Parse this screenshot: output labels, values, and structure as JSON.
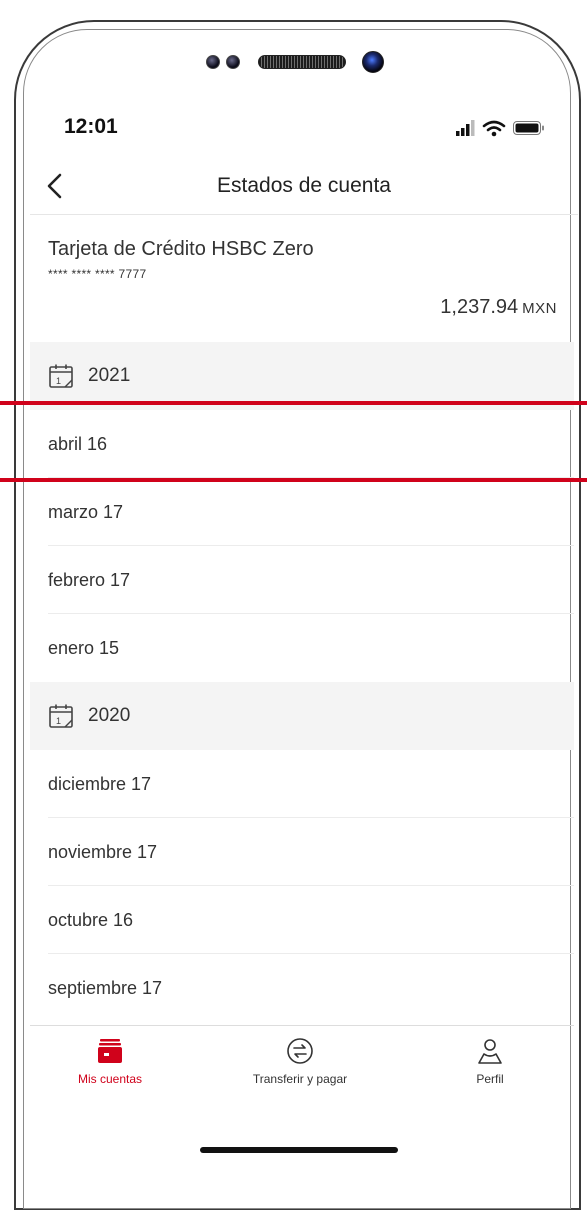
{
  "status_bar": {
    "time": "12:01"
  },
  "header": {
    "title": "Estados de cuenta",
    "back_icon": "chevron-left-icon"
  },
  "account": {
    "name": "Tarjeta de Crédito HSBC Zero",
    "masked_number": "**** **** **** 7777",
    "balance": "1,237.94",
    "currency": "MXN"
  },
  "statements": [
    {
      "year": "2021",
      "items": [
        "abril 16",
        "marzo 17",
        "febrero 17",
        "enero 15"
      ]
    },
    {
      "year": "2020",
      "items": [
        "diciembre 17",
        "noviembre 17",
        "octubre 16",
        "septiembre 17"
      ]
    }
  ],
  "tabbar": {
    "tabs": [
      {
        "label": "Mis cuentas",
        "icon": "wallet-icon",
        "active": true
      },
      {
        "label": "Transferir y pagar",
        "icon": "transfer-icon",
        "active": false
      },
      {
        "label": "Perfil",
        "icon": "profile-icon",
        "active": false
      }
    ]
  },
  "colors": {
    "accent": "#d0021b",
    "section_bg": "#f4f4f4",
    "text": "#333333"
  }
}
